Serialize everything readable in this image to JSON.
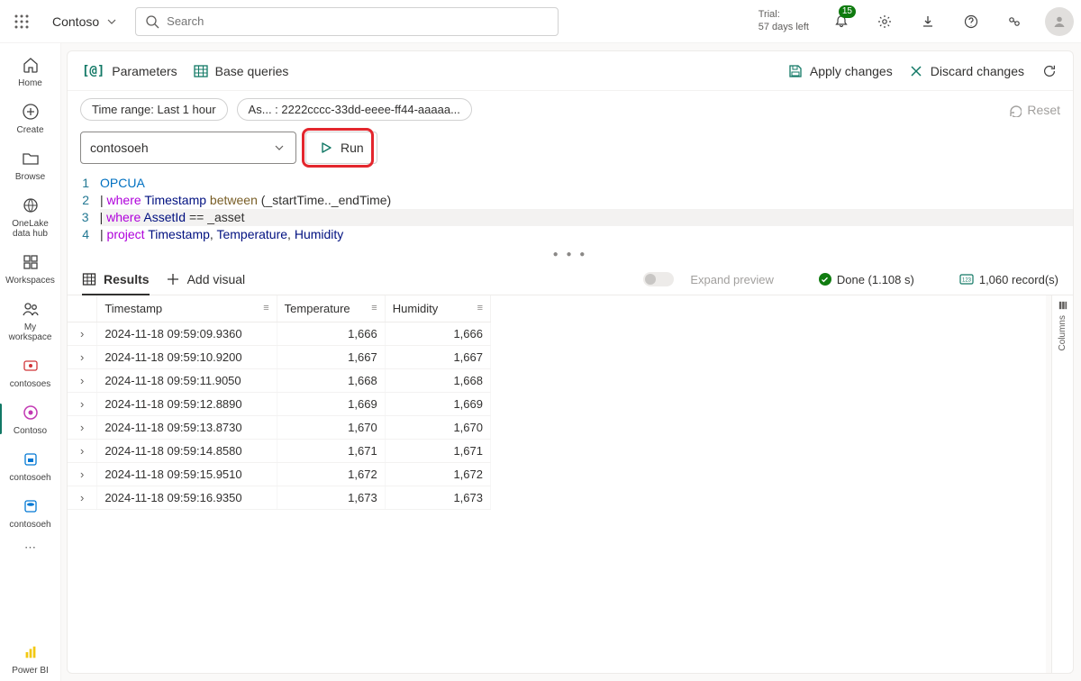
{
  "header": {
    "org": "Contoso",
    "search_placeholder": "Search",
    "trial_line1": "Trial:",
    "trial_line2": "57 days left",
    "alert_badge": "15"
  },
  "rail": {
    "items": [
      {
        "label": "Home"
      },
      {
        "label": "Create"
      },
      {
        "label": "Browse"
      },
      {
        "label": "OneLake data hub"
      },
      {
        "label": "Workspaces"
      },
      {
        "label": "My workspace"
      },
      {
        "label": "contosoes"
      },
      {
        "label": "Contoso",
        "selected": true
      },
      {
        "label": "contosoeh"
      },
      {
        "label": "contosoeh"
      }
    ],
    "bottom_label": "Power BI"
  },
  "toolbar": {
    "parameters": "Parameters",
    "base_queries": "Base queries",
    "apply": "Apply changes",
    "discard": "Discard changes"
  },
  "pills": {
    "time_range": "Time range: Last 1 hour",
    "asset": "As... : 2222cccc-33dd-eeee-ff44-aaaaa...",
    "reset": "Reset"
  },
  "source": {
    "selected": "contosoeh",
    "run": "Run"
  },
  "editor": {
    "lines": [
      {
        "n": "1",
        "tokens": [
          [
            "tbl",
            "OPCUA"
          ]
        ]
      },
      {
        "n": "2",
        "tokens": [
          [
            "pipe",
            "| "
          ],
          [
            "kw",
            "where"
          ],
          [
            "punc",
            " "
          ],
          [
            "col",
            "Timestamp"
          ],
          [
            "punc",
            " "
          ],
          [
            "fn",
            "between"
          ],
          [
            "punc",
            " (_startTime.._endTime)"
          ]
        ]
      },
      {
        "n": "3",
        "hl": true,
        "tokens": [
          [
            "pipe",
            "| "
          ],
          [
            "kw",
            "where"
          ],
          [
            "punc",
            " "
          ],
          [
            "col",
            "AssetId"
          ],
          [
            "punc",
            " == _asset"
          ]
        ]
      },
      {
        "n": "4",
        "tokens": [
          [
            "pipe",
            "| "
          ],
          [
            "kw",
            "project"
          ],
          [
            "punc",
            " "
          ],
          [
            "col",
            "Timestamp"
          ],
          [
            "punc",
            ", "
          ],
          [
            "col",
            "Temperature"
          ],
          [
            "punc",
            ", "
          ],
          [
            "col",
            "Humidity"
          ]
        ]
      }
    ]
  },
  "results": {
    "tab_results": "Results",
    "tab_addvisual": "Add visual",
    "expand_preview": "Expand preview",
    "done": "Done (1.108 s)",
    "record_count": "1,060 record(s)",
    "columns_label": "Columns",
    "columns": [
      "Timestamp",
      "Temperature",
      "Humidity"
    ],
    "rows": [
      [
        "2024-11-18 09:59:09.9360",
        "1,666",
        "1,666"
      ],
      [
        "2024-11-18 09:59:10.9200",
        "1,667",
        "1,667"
      ],
      [
        "2024-11-18 09:59:11.9050",
        "1,668",
        "1,668"
      ],
      [
        "2024-11-18 09:59:12.8890",
        "1,669",
        "1,669"
      ],
      [
        "2024-11-18 09:59:13.8730",
        "1,670",
        "1,670"
      ],
      [
        "2024-11-18 09:59:14.8580",
        "1,671",
        "1,671"
      ],
      [
        "2024-11-18 09:59:15.9510",
        "1,672",
        "1,672"
      ],
      [
        "2024-11-18 09:59:16.9350",
        "1,673",
        "1,673"
      ]
    ]
  }
}
